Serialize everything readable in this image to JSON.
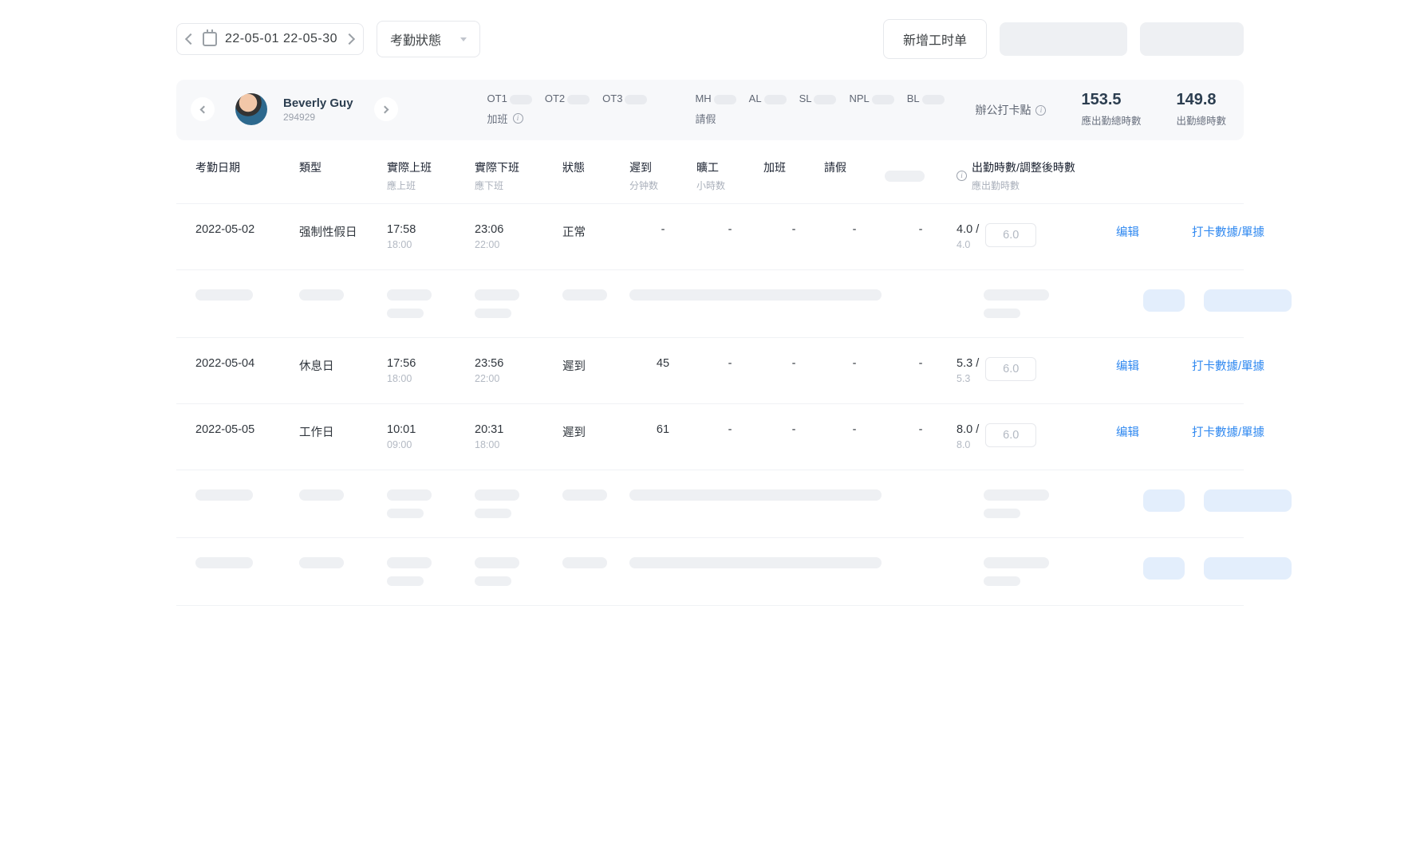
{
  "toolbar": {
    "date_range": "22-05-01 22-05-30",
    "status_label": "考勤狀態",
    "add_timesheet": "新增工时单"
  },
  "summary": {
    "person": {
      "name": "Beverly Guy",
      "id": "294929"
    },
    "overtime": {
      "ot1": "OT1",
      "ot2": "OT2",
      "ot3": "OT3",
      "label": "加班"
    },
    "leave": {
      "mh": "MH",
      "al": "AL",
      "sl": "SL",
      "npl": "NPL",
      "bl": "BL",
      "label": "請假"
    },
    "office_point": "辦公打卡點",
    "metric_required": {
      "value": "153.5",
      "label": "應出勤總時數"
    },
    "metric_actual": {
      "value": "149.8",
      "label": "出勤總時數"
    }
  },
  "columns": {
    "date": "考勤日期",
    "type": "類型",
    "actual_in": "實際上班",
    "actual_in_sub": "應上班",
    "actual_out": "實際下班",
    "actual_out_sub": "應下班",
    "status": "狀態",
    "late": "遲到",
    "late_sub": "分钟数",
    "absent": "曠工",
    "absent_sub": "小時数",
    "overtime": "加班",
    "leave": "請假",
    "hours": "出勤時數/調整後時數",
    "hours_sub": "應出勤時數"
  },
  "row_actions": {
    "edit": "编辑",
    "details": "打卡數據/單據"
  },
  "rows": [
    {
      "date": "2022-05-02",
      "type": "强制性假日",
      "in_actual": "17:58",
      "in_sched": "18:00",
      "out_actual": "23:06",
      "out_sched": "22:00",
      "status": "正常",
      "late": "-",
      "absent": "-",
      "ot": "-",
      "leave": "-",
      "col10": "-",
      "hours_actual": "4.0",
      "hours_adj": "6.0",
      "hours_req": "4.0"
    },
    {
      "skeleton": true
    },
    {
      "date": "2022-05-04",
      "type": "休息日",
      "in_actual": "17:56",
      "in_sched": "18:00",
      "out_actual": "23:56",
      "out_sched": "22:00",
      "status": "遲到",
      "late": "45",
      "absent": "-",
      "ot": "-",
      "leave": "-",
      "col10": "-",
      "hours_actual": "5.3",
      "hours_adj": "6.0",
      "hours_req": "5.3"
    },
    {
      "date": "2022-05-05",
      "type": "工作日",
      "in_actual": "10:01",
      "in_sched": "09:00",
      "out_actual": "20:31",
      "out_sched": "18:00",
      "status": "遲到",
      "late": "61",
      "absent": "-",
      "ot": "-",
      "leave": "-",
      "col10": "-",
      "hours_actual": "8.0",
      "hours_adj": "6.0",
      "hours_req": "8.0"
    },
    {
      "skeleton": true
    },
    {
      "skeleton": true
    }
  ]
}
